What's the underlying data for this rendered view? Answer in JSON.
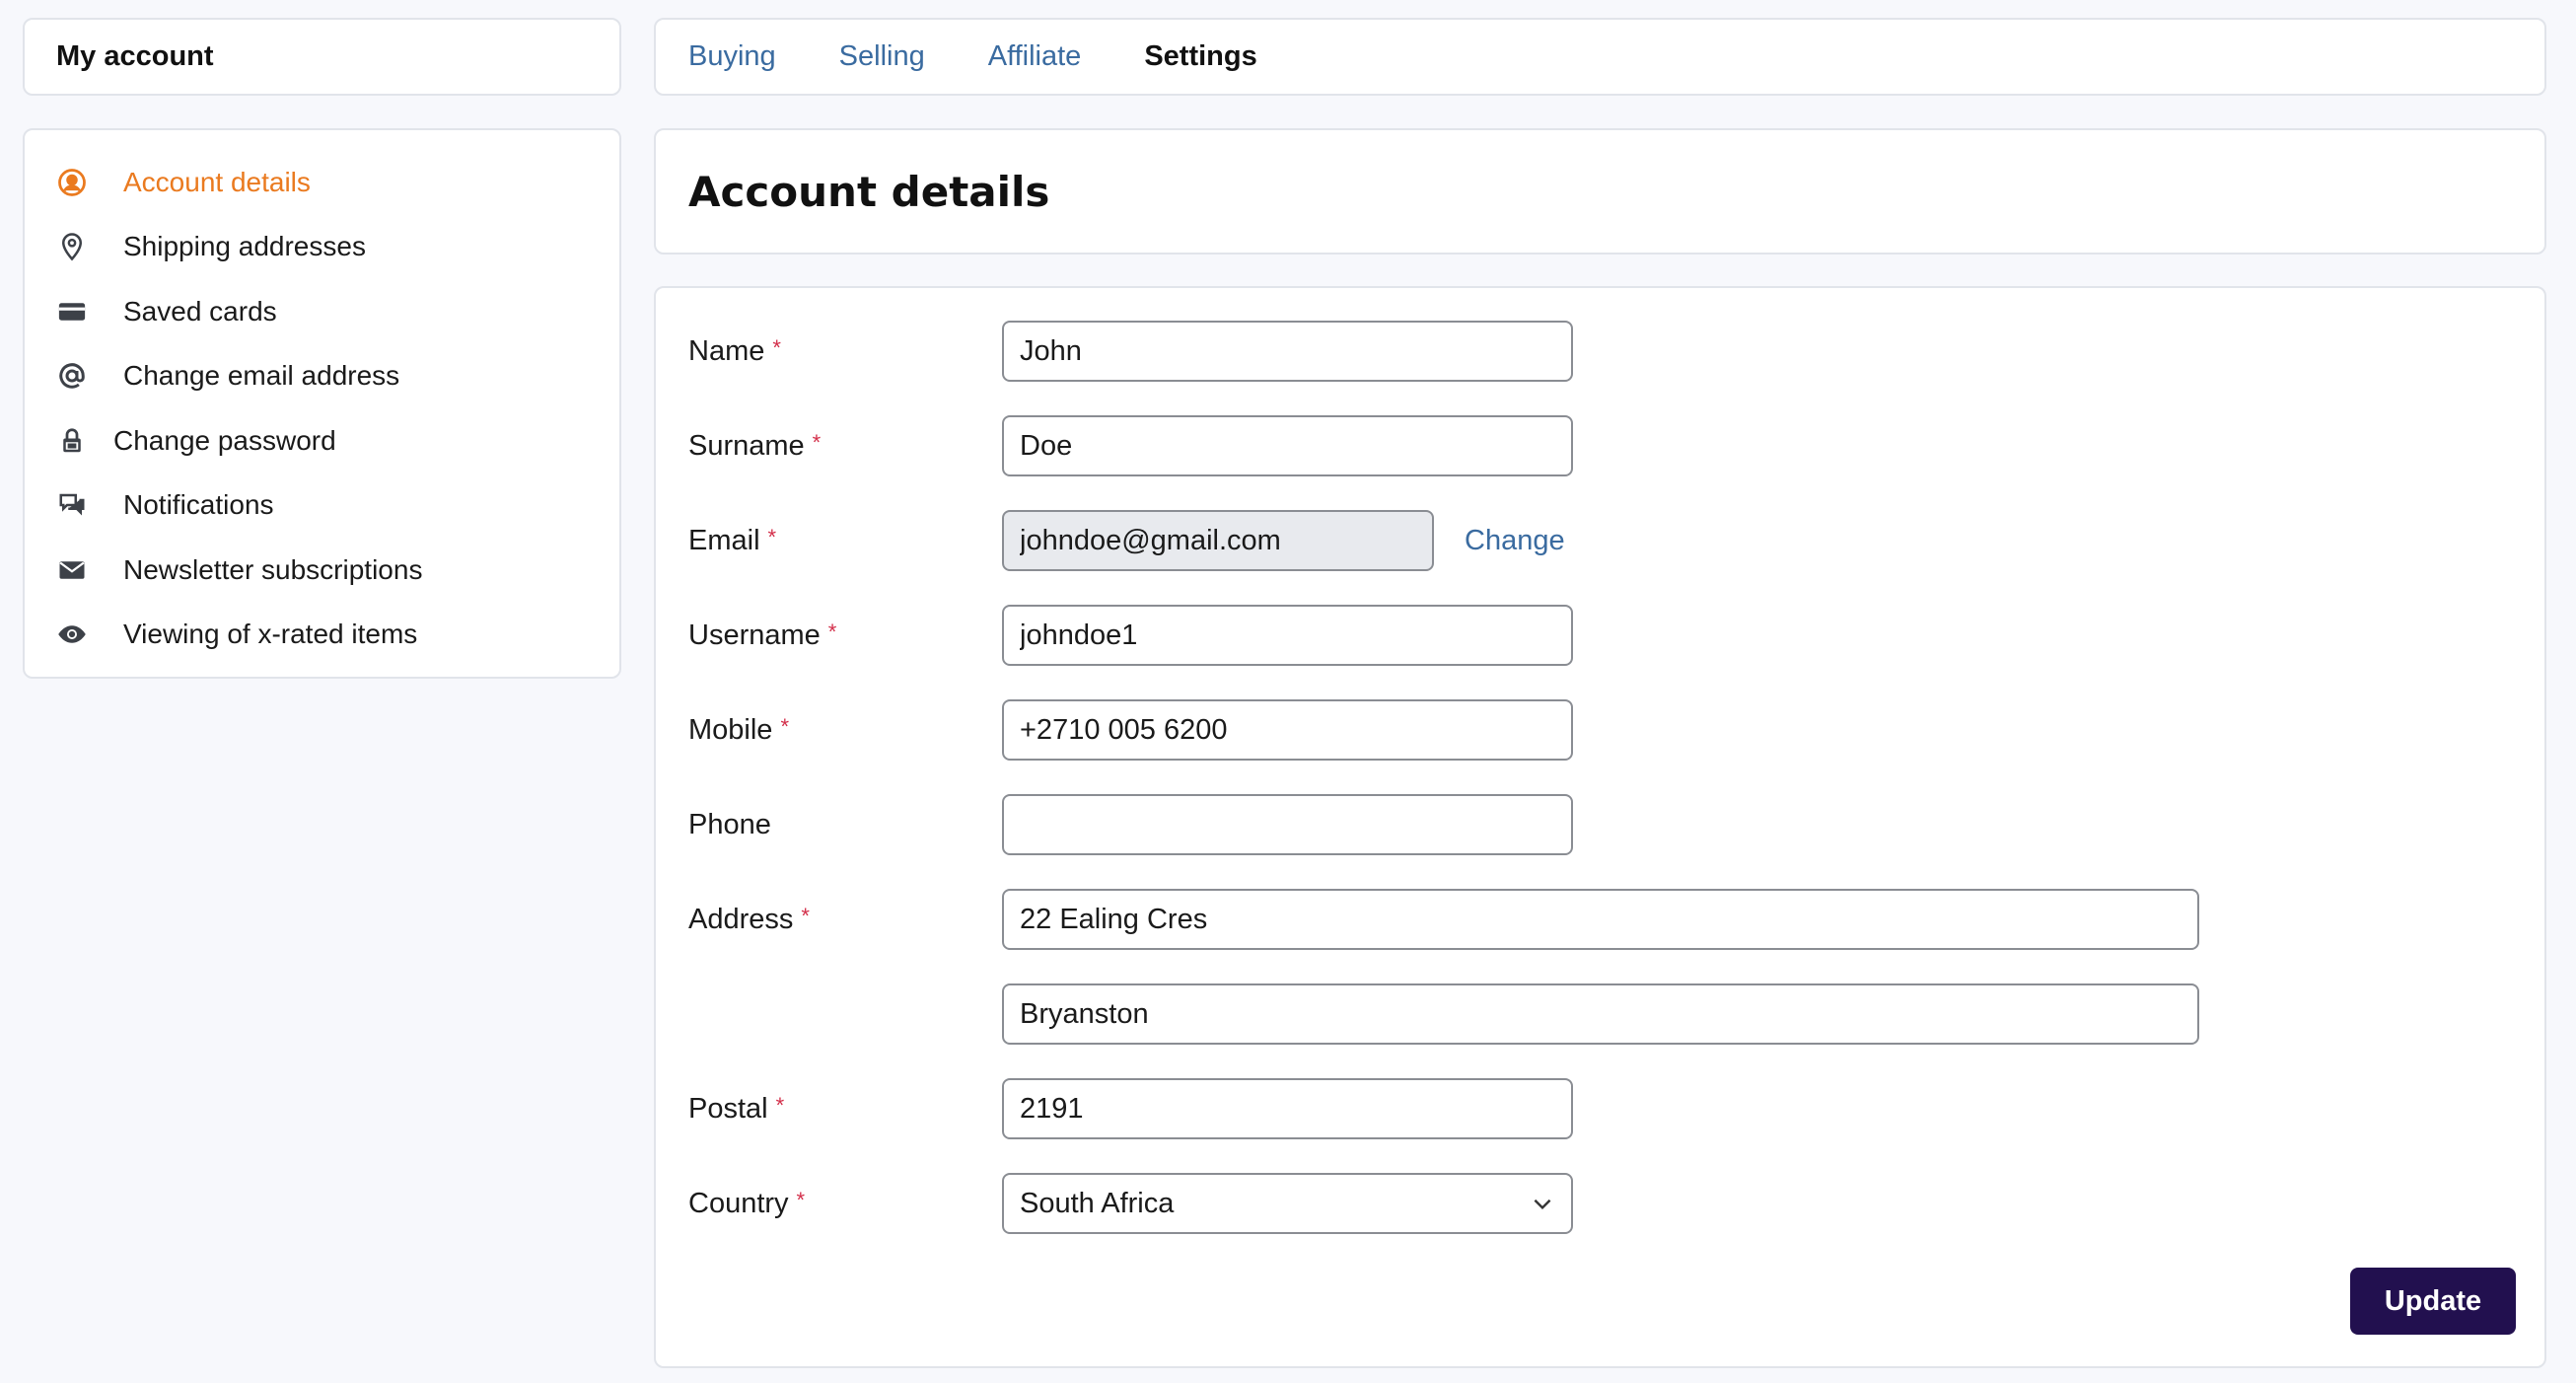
{
  "sidebar": {
    "title": "My account",
    "items": [
      {
        "label": "Account details",
        "icon": "user-circle-icon",
        "active": true
      },
      {
        "label": "Shipping addresses",
        "icon": "map-pin-icon"
      },
      {
        "label": "Saved cards",
        "icon": "credit-card-icon"
      },
      {
        "label": "Change email address",
        "icon": "at-sign-icon"
      },
      {
        "label": "Change password",
        "icon": "lock-icon"
      },
      {
        "label": "Notifications",
        "icon": "chat-bubbles-icon"
      },
      {
        "label": "Newsletter subscriptions",
        "icon": "envelope-icon"
      },
      {
        "label": "Viewing of x-rated items",
        "icon": "eye-icon"
      }
    ]
  },
  "tabs": [
    {
      "label": "Buying"
    },
    {
      "label": "Selling"
    },
    {
      "label": "Affiliate"
    },
    {
      "label": "Settings",
      "current": true
    }
  ],
  "page": {
    "title": "Account details"
  },
  "form": {
    "name": {
      "label": "Name",
      "value": "John"
    },
    "surname": {
      "label": "Surname",
      "value": "Doe"
    },
    "email": {
      "label": "Email",
      "value": "johndoe@gmail.com",
      "change_label": "Change"
    },
    "username": {
      "label": "Username",
      "value": "johndoe1"
    },
    "mobile": {
      "label": "Mobile",
      "value": "+2710 005 6200"
    },
    "phone": {
      "label": "Phone",
      "value": ""
    },
    "address": {
      "label": "Address",
      "line1": "22 Ealing Cres",
      "line2": "Bryanston"
    },
    "postal": {
      "label": "Postal",
      "value": "2191"
    },
    "country": {
      "label": "Country",
      "value": "South Africa"
    },
    "required_mark": "*",
    "submit_label": "Update"
  },
  "colors": {
    "accent": "#ea7a1f",
    "link": "#3a6ba0",
    "button": "#22104f",
    "required": "#d32f4a"
  }
}
